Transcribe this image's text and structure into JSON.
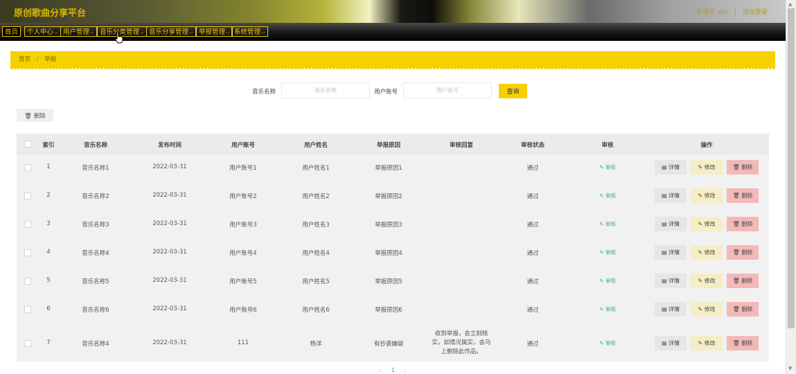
{
  "header": {
    "title": "原创歌曲分享平台",
    "admin_label": "管理员 abo",
    "logout_label": "退出登录"
  },
  "nav": {
    "items": [
      {
        "label": "首页",
        "has_dropdown": false
      },
      {
        "label": "个人中心",
        "has_dropdown": true
      },
      {
        "label": "用户管理",
        "has_dropdown": true
      },
      {
        "label": "音乐分类管理",
        "has_dropdown": true
      },
      {
        "label": "音乐分享管理",
        "has_dropdown": true
      },
      {
        "label": "举报管理",
        "has_dropdown": true
      },
      {
        "label": "系统管理",
        "has_dropdown": true
      }
    ]
  },
  "breadcrumb": {
    "home": "首页",
    "separator": "/",
    "current": "举报"
  },
  "search": {
    "music_label": "音乐名称",
    "music_placeholder": "音乐名称",
    "account_label": "用户账号",
    "account_placeholder": "用户账号",
    "query_label": "查询"
  },
  "toolbar": {
    "delete_label": "删除"
  },
  "table": {
    "headers": [
      "索引",
      "音乐名称",
      "发布时间",
      "用户账号",
      "用户姓名",
      "举报原因",
      "审核回复",
      "审核状态",
      "审核",
      "操作"
    ],
    "rows": [
      {
        "index": "1",
        "music": "音乐名称1",
        "date": "2022-03-31",
        "account": "用户账号1",
        "name": "用户姓名1",
        "reason": "举报原因1",
        "reply": "",
        "status": "通过",
        "audit": "审核"
      },
      {
        "index": "2",
        "music": "音乐名称2",
        "date": "2022-03-31",
        "account": "用户账号2",
        "name": "用户姓名2",
        "reason": "举报原因2",
        "reply": "",
        "status": "通过",
        "audit": "审核"
      },
      {
        "index": "3",
        "music": "音乐名称3",
        "date": "2022-03-31",
        "account": "用户账号3",
        "name": "用户姓名3",
        "reason": "举报原因3",
        "reply": "",
        "status": "通过",
        "audit": "审核"
      },
      {
        "index": "4",
        "music": "音乐名称4",
        "date": "2022-03-31",
        "account": "用户账号4",
        "name": "用户姓名4",
        "reason": "举报原因4",
        "reply": "",
        "status": "通过",
        "audit": "审核"
      },
      {
        "index": "5",
        "music": "音乐名称5",
        "date": "2022-03-31",
        "account": "用户账号5",
        "name": "用户姓名5",
        "reason": "举报原因5",
        "reply": "",
        "status": "通过",
        "audit": "审核"
      },
      {
        "index": "6",
        "music": "音乐名称6",
        "date": "2022-03-31",
        "account": "用户账号6",
        "name": "用户姓名6",
        "reason": "举报原因6",
        "reply": "",
        "status": "通过",
        "audit": "审核"
      },
      {
        "index": "7",
        "music": "音乐名称4",
        "date": "2022-03-31",
        "account": "111",
        "name": "杨洋",
        "reason": "有抄袭嫌疑",
        "reply": "收到举报，会立刻核实，如情况属实，会马上删除此作品。",
        "status": "通过",
        "audit": "审核"
      }
    ],
    "actions": {
      "detail": "详情",
      "edit": "修改",
      "delete": "删除"
    }
  },
  "pagination": {
    "prev": "‹",
    "current": "1",
    "next": "›"
  },
  "colors": {
    "accent": "#f5d100",
    "nav_text": "#f3c800",
    "audit_link": "#3cb371",
    "delete_button": "#f3b8b8",
    "edit_button": "#f5eec5"
  },
  "icons": {
    "chevron": "chevron-down-icon",
    "trash": "trash-icon",
    "detail": "document-icon",
    "edit": "pencil-icon"
  }
}
